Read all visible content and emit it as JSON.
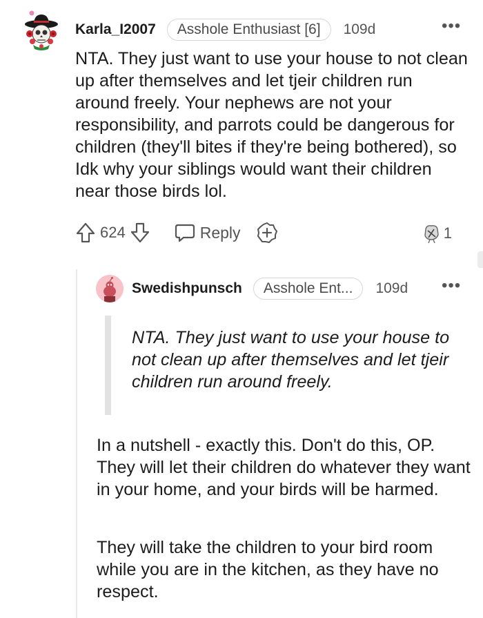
{
  "comment": {
    "username": "Karla_I2007",
    "flair": "Asshole Enthusiast [6]",
    "age": "109d",
    "more_label": "•••",
    "body": "NTA. They just want to use your house to not clean up after themselves and let tjeir children run around freely. Your nephews are not your responsibility, and parrots could be dangerous for children (they'll bites if they're being bothered), so Idk why your siblings would want their children near those birds lol.",
    "score": "624",
    "reply_label": "Reply",
    "award_count": "1",
    "icons": {
      "avatar": "skull-sombrero-avatar-icon",
      "upvote": "upvote-arrow-icon",
      "downvote": "downvote-arrow-icon",
      "reply": "speech-bubble-icon",
      "give_award": "add-award-icon",
      "award": "award-badge-icon"
    }
  },
  "reply": {
    "username": "Swedishpunsch",
    "flair": "Asshole Ent...",
    "age": "109d",
    "more_label": "•••",
    "quote": "NTA. They just want to use your house to not clean up after themselves and let tjeir children run around freely.",
    "paragraphs": [
      "In a nutshell - exactly this. Don't do this, OP. They will let their children do whatever they want in your home, and your birds will be harmed.",
      "They will take the children to your bird room while you are in the kitchen, as they have no respect."
    ],
    "icons": {
      "avatar": "snoo-avatar-icon"
    }
  },
  "colors": {
    "text": "#1c1c1c",
    "muted": "#555555",
    "flair_border": "#d6d6d6",
    "quote_bar": "#e2e2e2",
    "avatar_bg": "#f7c3c9"
  }
}
